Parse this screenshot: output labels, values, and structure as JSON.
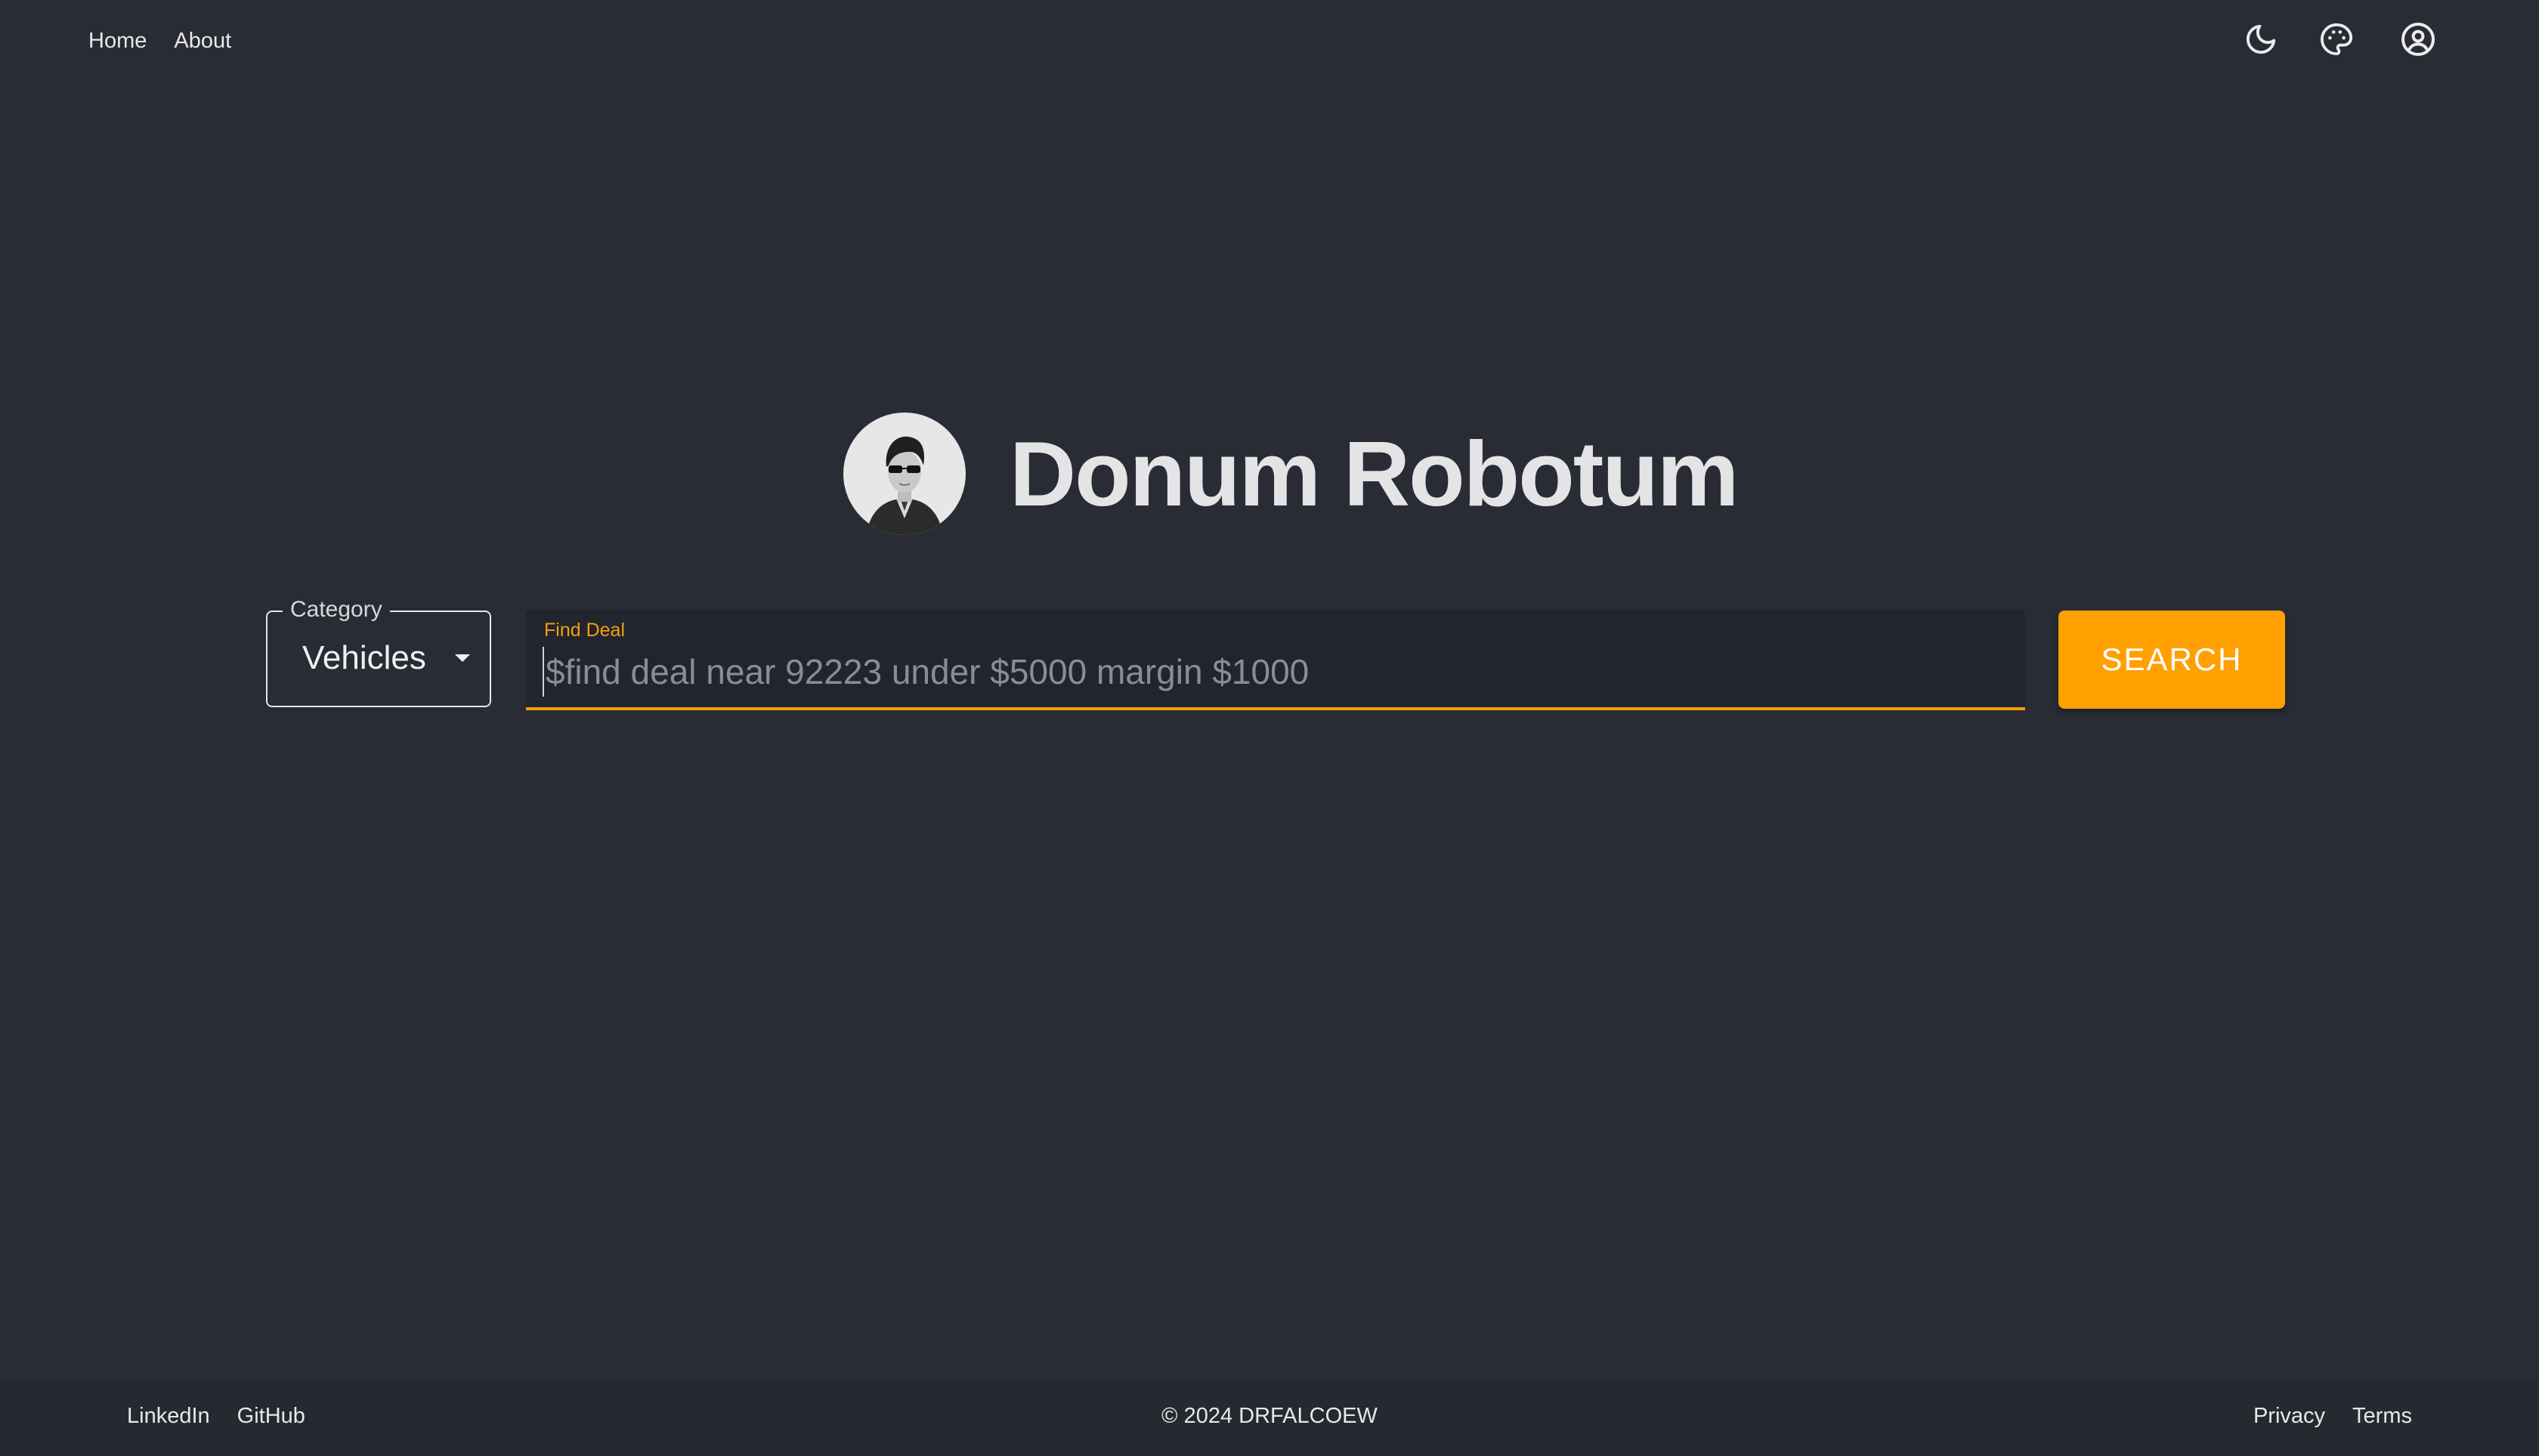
{
  "nav": {
    "links": [
      {
        "label": "Home"
      },
      {
        "label": "About"
      }
    ],
    "icons": [
      "moon-icon",
      "palette-icon",
      "user-account-icon"
    ]
  },
  "hero": {
    "title": "Donum Robotum",
    "avatar": "avatar-portrait-sunglasses"
  },
  "search": {
    "category_label": "Category",
    "category_value": "Vehicles",
    "find_label": "Find Deal",
    "placeholder": "$find deal near 92223 under $5000 margin $1000",
    "value": "",
    "button_label": "SEARCH"
  },
  "footer": {
    "left_links": [
      {
        "label": "LinkedIn"
      },
      {
        "label": "GitHub"
      }
    ],
    "copyright": "© 2024 DRFALCOEW",
    "right_links": [
      {
        "label": "Privacy"
      },
      {
        "label": "Terms"
      }
    ]
  },
  "colors": {
    "background": "#292c35",
    "accent": "#ffa000",
    "input_underline": "#f59e0b",
    "footer_background": "#262930"
  }
}
